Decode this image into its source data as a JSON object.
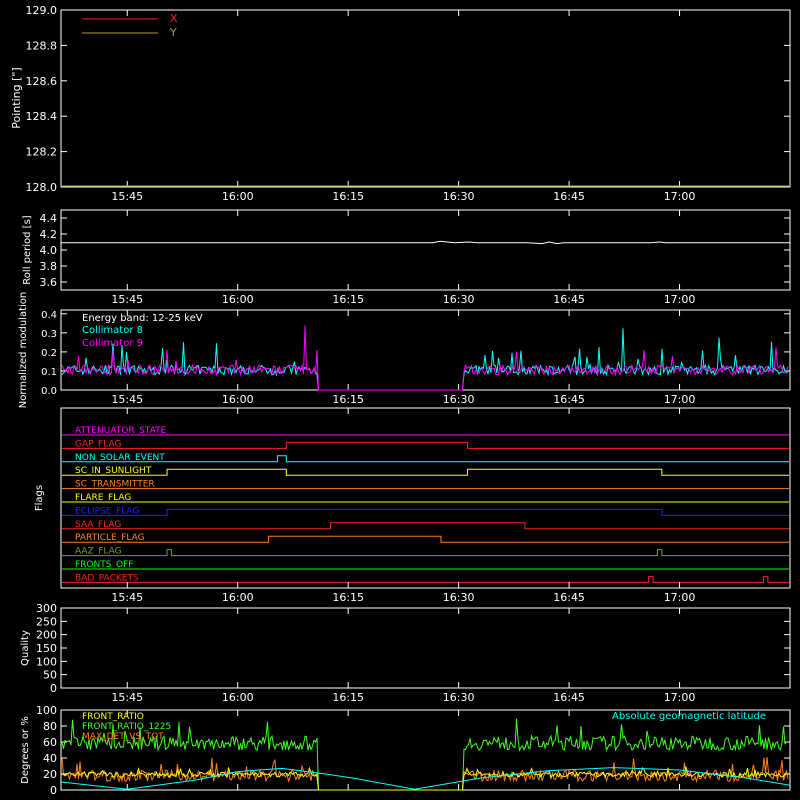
{
  "time_ticks": [
    "15:45",
    "16:00",
    "16:15",
    "16:30",
    "16:45",
    "17:00"
  ],
  "colors": {
    "background": "#000000",
    "axes": "#ffffff",
    "red": "#ff2020",
    "yellow": "#ffff00",
    "olive": "#b0a020",
    "cyan": "#00ffff",
    "magenta": "#ff00ff",
    "orange": "#ff8020",
    "blue": "#2020ff",
    "green": "#00ff00",
    "lime": "#40ff20",
    "grey_green": "#7a9a20"
  },
  "chart_data": [
    {
      "type": "line",
      "ylabel": "Pointing [\"]",
      "ylim": [
        128.0,
        129.0
      ],
      "yticks": [
        "129.0",
        "128.8",
        "128.6",
        "128.4",
        "128.2",
        "128.0"
      ],
      "grid": false,
      "legend_placement": "top-left",
      "series": [
        {
          "name": "X",
          "color": "#ff2020",
          "x": [
            0,
            100
          ],
          "values": [
            128.0,
            128.0
          ]
        },
        {
          "name": "Y",
          "color": "#b0a020",
          "x": [
            0,
            100
          ],
          "values": [
            128.0,
            128.0
          ]
        }
      ]
    },
    {
      "type": "line",
      "ylabel": "Roll period [s]",
      "ylim": [
        3.5,
        4.5
      ],
      "yticks": [
        "4.4",
        "4.2",
        "4.0",
        "3.8",
        "3.6"
      ],
      "series": [
        {
          "color": "#ffffff",
          "x": [
            0,
            51,
            52,
            53,
            54,
            56,
            57,
            64,
            66,
            67,
            68,
            69,
            70,
            81,
            82,
            83,
            100
          ],
          "values": [
            4.09,
            4.09,
            4.11,
            4.1,
            4.09,
            4.1,
            4.09,
            4.09,
            4.08,
            4.1,
            4.08,
            4.09,
            4.09,
            4.09,
            4.1,
            4.09,
            4.09
          ]
        }
      ]
    },
    {
      "type": "line",
      "ylabel": "Normalized modulation",
      "ylim": [
        0,
        0.42
      ],
      "yticks": [
        "0.4",
        "0.3",
        "0.2",
        "0.1",
        "0.0"
      ],
      "annotation": "Energy band: 12-25 keV",
      "series": [
        {
          "name": "Collimator 8",
          "color": "#00ffff"
        },
        {
          "name": "Collimator 9",
          "color": "#ff00ff"
        }
      ]
    },
    {
      "type": "line",
      "ylabel": "Flags",
      "flags": [
        {
          "name": "ATTENUATOR_STATE",
          "color": "#ff00ff",
          "on": []
        },
        {
          "name": "GAP_FLAG",
          "color": "#ff2020",
          "on": [
            [
              16.11,
              16.52
            ]
          ]
        },
        {
          "name": "NON_SOLAR_EVENT",
          "color": "#00ffff",
          "on": [
            [
              16.09,
              16.11
            ]
          ]
        },
        {
          "name": "SC_IN_SUNLIGHT",
          "color": "#ffff00",
          "on": [
            [
              15.84,
              16.11
            ],
            [
              16.52,
              16.96
            ]
          ]
        },
        {
          "name": "SC_TRANSMITTER",
          "color": "#ff8020",
          "on": []
        },
        {
          "name": "FLARE_FLAG",
          "color": "#ffff00",
          "on": []
        },
        {
          "name": "ECLIPSE_FLAG",
          "color": "#2020ff",
          "on": [
            [
              15.84,
              16.96
            ]
          ]
        },
        {
          "name": "SAA_FLAG",
          "color": "#ff2020",
          "on": [
            [
              16.21,
              16.65
            ]
          ]
        },
        {
          "name": "PARTICLE_FLAG",
          "color": "#ff8020",
          "on": [
            [
              16.07,
              16.46
            ]
          ]
        },
        {
          "name": "AAZ_FLAG",
          "color": "#7a9a20",
          "on": [
            [
              15.84,
              15.85
            ],
            [
              16.95,
              16.96
            ]
          ]
        },
        {
          "name": "FRONTS_OFF",
          "color": "#00ff00",
          "on": []
        },
        {
          "name": "BAD_PACKETS",
          "color": "#ff2020",
          "on": [
            [
              16.93,
              16.94
            ],
            [
              17.19,
              17.2
            ]
          ]
        }
      ]
    },
    {
      "type": "line",
      "ylabel": "Quality",
      "ylim": [
        0,
        300
      ],
      "yticks": [
        "300",
        "250",
        "200",
        "150",
        "100",
        "50",
        "0"
      ],
      "series": []
    },
    {
      "type": "line",
      "ylabel": "Degrees or %",
      "ylim": [
        0,
        100
      ],
      "yticks": [
        "100",
        "80",
        "60",
        "40",
        "20",
        "0"
      ],
      "annotation": "Absolute geomagnetic latitude",
      "series": [
        {
          "name": "FRONT_RATIO",
          "color": "#ffff00"
        },
        {
          "name": "FRONT_RATIO_1225",
          "color": "#40ff20"
        },
        {
          "name": "MAX_DET_VS_TOT",
          "color": "#ff8020"
        },
        {
          "name": "Absolute geomagnetic latitude",
          "color": "#00ffff",
          "x": [
            15.6,
            15.75,
            15.9,
            16.0,
            16.1,
            16.2,
            16.27,
            16.4,
            16.55,
            16.7,
            16.85,
            17.0,
            17.15,
            17.25
          ],
          "values": [
            10,
            1,
            12,
            23,
            27,
            20,
            14,
            1,
            15,
            24,
            28,
            25,
            15,
            6
          ]
        }
      ]
    }
  ]
}
